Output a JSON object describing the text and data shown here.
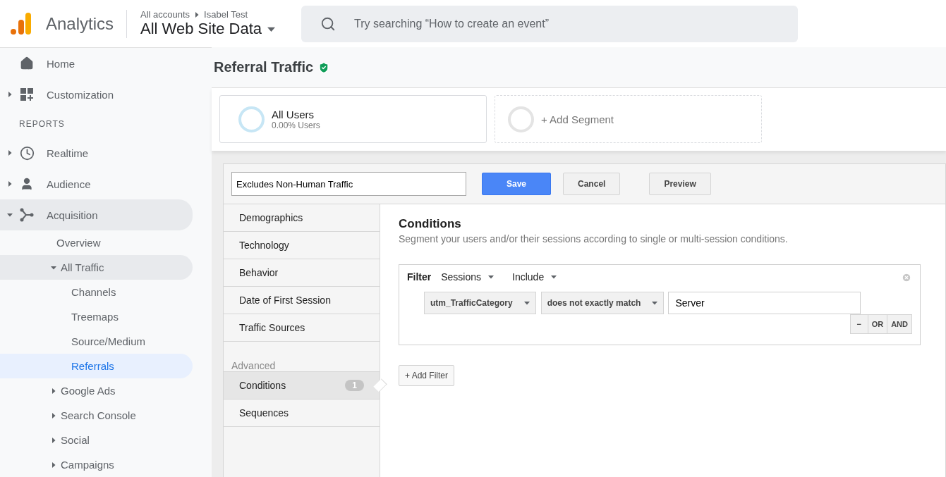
{
  "header": {
    "product": "Analytics",
    "breadcrumb": [
      "All accounts",
      "Isabel Test"
    ],
    "view": "All Web Site Data",
    "search": {
      "placeholder": "Try searching “How to create an event”"
    }
  },
  "sidebar": {
    "items": [
      {
        "kind": "item",
        "label": "Home",
        "selected": false
      },
      {
        "kind": "item",
        "label": "Customization",
        "selected": false,
        "expanded": false
      },
      {
        "kind": "heading",
        "label": "REPORTS"
      },
      {
        "kind": "item",
        "label": "Realtime",
        "selected": false,
        "expanded": false
      },
      {
        "kind": "item",
        "label": "Audience",
        "selected": false,
        "expanded": false
      },
      {
        "kind": "item",
        "label": "Acquisition",
        "selected": false,
        "expanded": true,
        "children": [
          {
            "kind": "item",
            "label": "Overview",
            "selected": false
          },
          {
            "kind": "item",
            "label": "All Traffic",
            "selected": false,
            "expanded": true,
            "children": [
              {
                "kind": "item",
                "label": "Channels",
                "selected": false
              },
              {
                "kind": "item",
                "label": "Treemaps",
                "selected": false
              },
              {
                "kind": "item",
                "label": "Source/Medium",
                "selected": false
              },
              {
                "kind": "item",
                "label": "Referrals",
                "selected": true
              }
            ]
          },
          {
            "kind": "item",
            "label": "Google Ads",
            "selected": false,
            "expanded": false
          },
          {
            "kind": "item",
            "label": "Search Console",
            "selected": false,
            "expanded": false
          },
          {
            "kind": "item",
            "label": "Social",
            "selected": false,
            "expanded": false
          },
          {
            "kind": "item",
            "label": "Campaigns",
            "selected": false,
            "expanded": false
          }
        ]
      }
    ]
  },
  "page_title": "Referral Traffic",
  "segments": [
    {
      "kind": "active",
      "name": "All Users",
      "detail": "0.00% Users"
    },
    {
      "kind": "add",
      "name": "+ Add Segment"
    }
  ],
  "editor": {
    "name_field": {
      "value": "Excludes Non-Human Traffic"
    },
    "buttons": [
      {
        "label": "Save",
        "kind": "primary"
      },
      {
        "label": "Cancel",
        "kind": "default"
      },
      {
        "label": "Preview",
        "kind": "default"
      }
    ],
    "menu": [
      {
        "kind": "item",
        "label": "Demographics",
        "selected": false
      },
      {
        "kind": "item",
        "label": "Technology",
        "selected": false
      },
      {
        "kind": "item",
        "label": "Behavior",
        "selected": false
      },
      {
        "kind": "item",
        "label": "Date of First Session",
        "selected": false
      },
      {
        "kind": "item",
        "label": "Traffic Sources",
        "selected": false
      },
      {
        "kind": "group",
        "label": "Advanced"
      },
      {
        "kind": "item",
        "label": "Conditions",
        "selected": true,
        "badge": "1"
      },
      {
        "kind": "item",
        "label": "Sequences",
        "selected": false
      }
    ],
    "conditions": {
      "title": "Conditions",
      "description": "Segment your users and/or their sessions according to single or multi-session conditions.",
      "filter": {
        "label": "Filter",
        "scope": "Sessions",
        "mode": "Include",
        "dimension": "utm_TrafficCategory",
        "operator": "does not exactly match",
        "value": "Server",
        "actions": [
          "−",
          "OR",
          "AND"
        ]
      },
      "add_filter": "+ Add Filter"
    }
  }
}
